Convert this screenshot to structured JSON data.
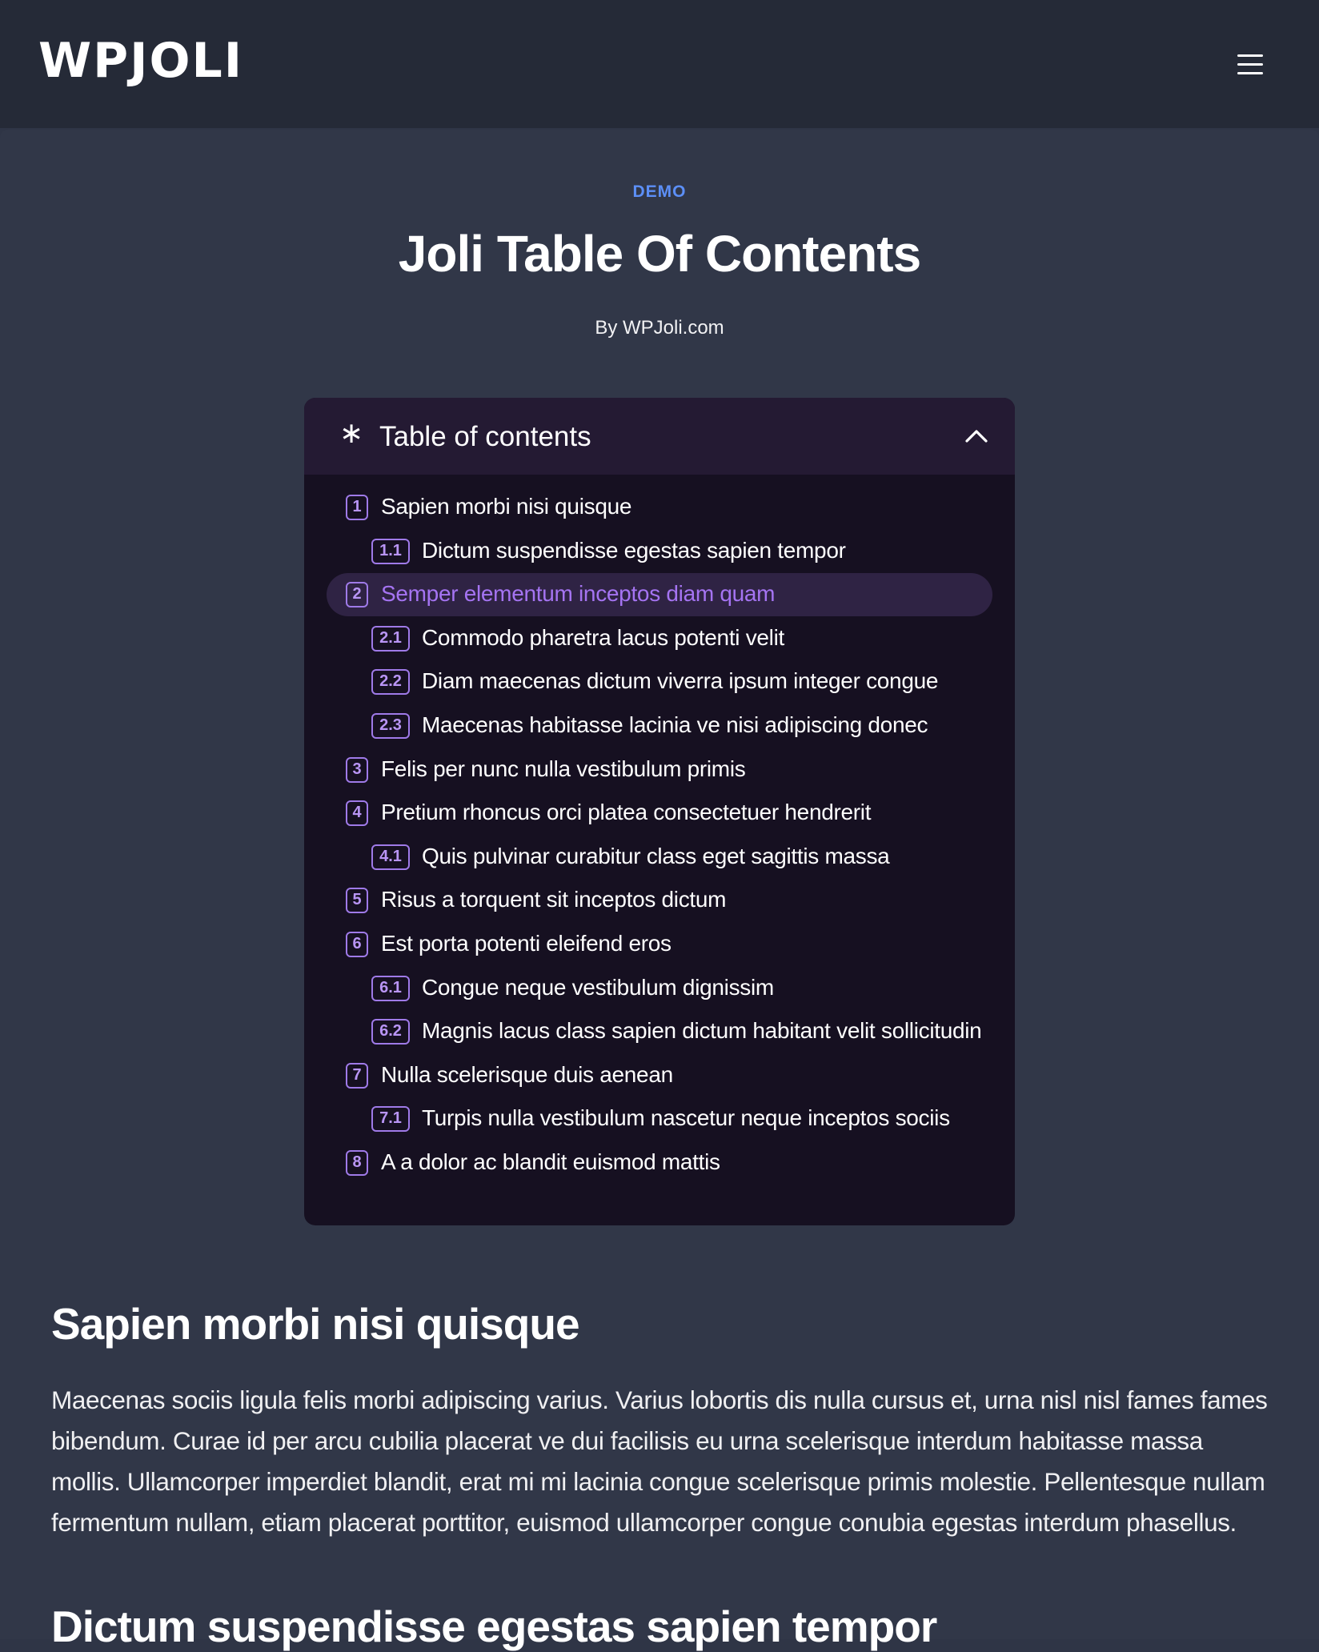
{
  "header": {
    "logo_text": "WPJOLI",
    "menu_icon": "hamburger-menu-icon"
  },
  "article": {
    "category": "DEMO",
    "title": "Joli Table Of Contents",
    "byline": "By WPJoli.com"
  },
  "toc": {
    "title": "Table of contents",
    "header_icon": "asterisk-icon",
    "toggle_icon": "chevron-up-icon",
    "accent_color": "#9f7ae8",
    "items": [
      {
        "number": "1",
        "label": "Sapien morbi nisi quisque",
        "level": 1
      },
      {
        "number": "1.1",
        "label": "Dictum suspendisse egestas sapien tempor",
        "level": 2
      },
      {
        "number": "2",
        "label": "Semper elementum inceptos diam quam",
        "level": 1,
        "active": true
      },
      {
        "number": "2.1",
        "label": "Commodo pharetra lacus potenti velit",
        "level": 2
      },
      {
        "number": "2.2",
        "label": "Diam maecenas dictum viverra ipsum integer congue",
        "level": 2
      },
      {
        "number": "2.3",
        "label": "Maecenas habitasse lacinia ve nisi adipiscing donec",
        "level": 2
      },
      {
        "number": "3",
        "label": "Felis per nunc nulla vestibulum primis",
        "level": 1
      },
      {
        "number": "4",
        "label": "Pretium rhoncus orci platea consectetuer hendrerit",
        "level": 1
      },
      {
        "number": "4.1",
        "label": "Quis pulvinar curabitur class eget sagittis massa",
        "level": 2
      },
      {
        "number": "5",
        "label": "Risus a torquent sit inceptos dictum",
        "level": 1
      },
      {
        "number": "6",
        "label": "Est porta potenti eleifend eros",
        "level": 1
      },
      {
        "number": "6.1",
        "label": "Congue neque vestibulum dignissim",
        "level": 2
      },
      {
        "number": "6.2",
        "label": "Magnis lacus class sapien dictum habitant velit sollicitudin",
        "level": 2
      },
      {
        "number": "7",
        "label": "Nulla scelerisque duis aenean",
        "level": 1
      },
      {
        "number": "7.1",
        "label": "Turpis nulla vestibulum nascetur neque inceptos sociis",
        "level": 2
      },
      {
        "number": "8",
        "label": "A a dolor ac blandit euismod mattis",
        "level": 1
      }
    ]
  },
  "sections": [
    {
      "heading": "Sapien morbi nisi quisque",
      "body": "Maecenas sociis ligula felis morbi adipiscing varius. Varius lobortis dis nulla cursus et, urna nisl nisl fames fames bibendum. Curae id per arcu cubilia placerat ve dui facilisis eu urna scelerisque interdum habitasse massa mollis. Ullamcorper imperdiet blandit, erat mi mi lacinia congue scelerisque primis molestie. Pellentesque nullam fermentum nullam, etiam placerat porttitor, euismod ullamcorper congue conubia egestas interdum phasellus."
    },
    {
      "heading": "Dictum suspendisse egestas sapien tempor"
    }
  ]
}
